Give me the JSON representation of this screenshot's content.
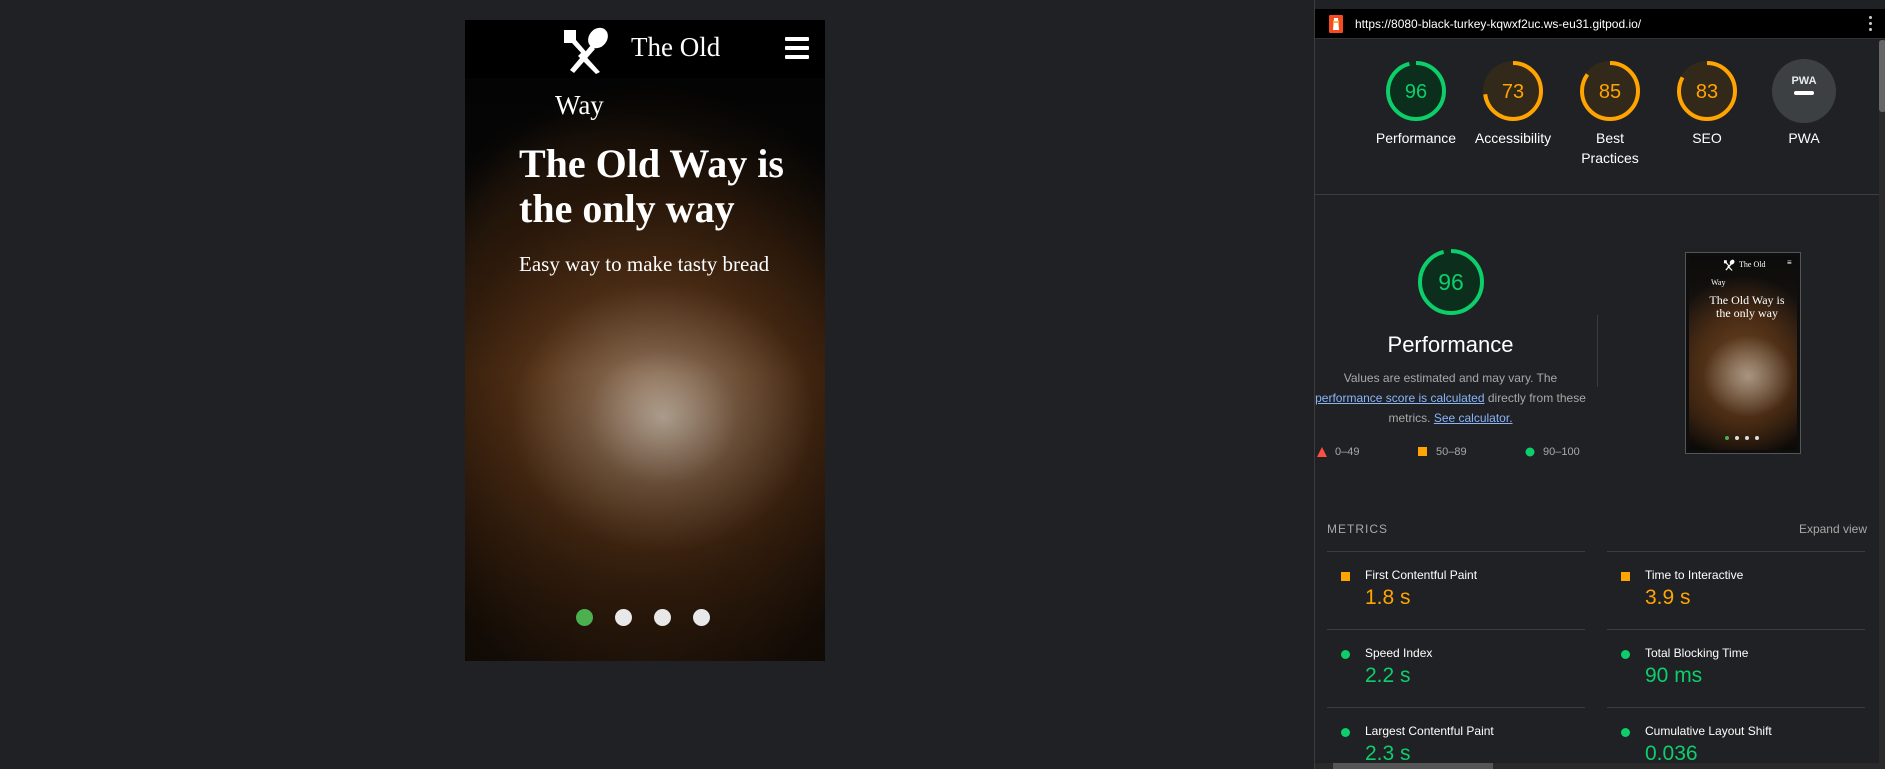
{
  "site": {
    "brand_line1": "The Old",
    "brand_line2": "Way",
    "hero_title": "The Old Way is the only way",
    "hero_subtitle": "Easy way to make tasty bread",
    "carousel_dots": 4,
    "carousel_active": 0
  },
  "lighthouse": {
    "url": "https://8080-black-turkey-kqwxf2uc.ws-eu31.gitpod.io/",
    "scores": [
      {
        "label": "Performance",
        "value": "96",
        "color": "#0cce6b"
      },
      {
        "label": "Accessibility",
        "value": "73",
        "color": "#ffa400"
      },
      {
        "label": "Best Practices",
        "value": "85",
        "color": "#ffa400"
      },
      {
        "label": "SEO",
        "value": "83",
        "color": "#ffa400"
      },
      {
        "label": "PWA",
        "value": "",
        "color": "#9aa0a6"
      }
    ],
    "pwa_badge": "PWA",
    "performance": {
      "score": "96",
      "title": "Performance",
      "desc_before": "Values are estimated and may vary. The ",
      "desc_link": "performance score is calculated",
      "desc_middle": " directly from these metrics. ",
      "desc_link2": "See calculator."
    },
    "legend": [
      "0–49",
      "50–89",
      "90–100"
    ],
    "metrics_heading": "METRICS",
    "expand_label": "Expand view",
    "metrics": [
      {
        "name": "First Contentful Paint",
        "value": "1.8 s",
        "status": "average"
      },
      {
        "name": "Time to Interactive",
        "value": "3.9 s",
        "status": "average"
      },
      {
        "name": "Speed Index",
        "value": "2.2 s",
        "status": "pass"
      },
      {
        "name": "Total Blocking Time",
        "value": "90 ms",
        "status": "pass"
      },
      {
        "name": "Largest Contentful Paint",
        "value": "2.3 s",
        "status": "pass"
      },
      {
        "name": "Cumulative Layout Shift",
        "value": "0.036",
        "status": "pass"
      }
    ],
    "thumbnail": {
      "brand_line1": "The Old",
      "brand_line2": "Way",
      "title": "The Old Way is the only way"
    }
  },
  "colors": {
    "pass": "#0cce6b",
    "average": "#ffa400",
    "fail": "#ff4e42"
  }
}
